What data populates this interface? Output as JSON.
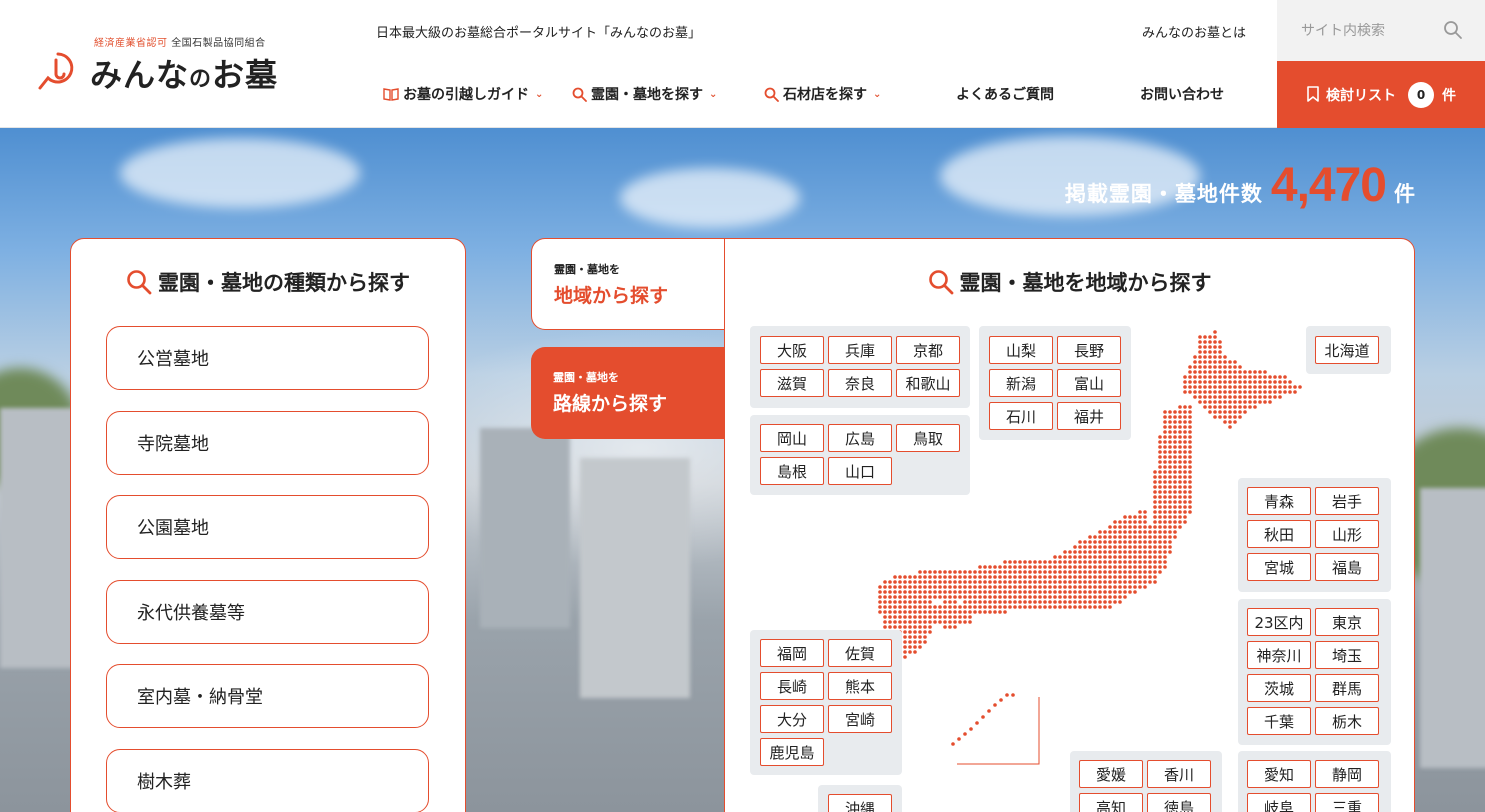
{
  "header": {
    "logo_sub_red": "経済産業省認可",
    "logo_sub": "全国石製品協同組合",
    "logo_name_1": "みんな",
    "logo_name_no": "の",
    "logo_name_2": "お墓",
    "tagline": "日本最大級のお墓総合ポータルサイト「みんなのお墓」",
    "about_link": "みんなのお墓とは",
    "search_placeholder": "サイト内検索",
    "nav": [
      {
        "label": "お墓の引越しガイド"
      },
      {
        "label": "霊園・墓地を探す"
      },
      {
        "label": "石材店を探す"
      },
      {
        "label": "よくあるご質問"
      },
      {
        "label": "お問い合わせ"
      }
    ],
    "list_button": {
      "label": "検討リスト",
      "count": "0",
      "unit": "件"
    }
  },
  "hero": {
    "count_label": "掲載霊園・墓地件数",
    "count_value": "4,470",
    "count_unit": "件"
  },
  "type_panel": {
    "title": "霊園・墓地の種類から探す",
    "items": [
      "公営墓地",
      "寺院墓地",
      "公園墓地",
      "永代供養墓等",
      "室内墓・納骨堂",
      "樹木葬"
    ]
  },
  "tabs": {
    "area": {
      "small": "霊園・墓地を",
      "big": "地域から探す"
    },
    "line": {
      "small": "霊園・墓地を",
      "big": "路線から探す"
    }
  },
  "region_panel": {
    "title": "霊園・墓地を地域から探す",
    "groups": {
      "kinki": [
        "大阪",
        "兵庫",
        "京都",
        "滋賀",
        "奈良",
        "和歌山"
      ],
      "chugoku": [
        "岡山",
        "広島",
        "鳥取",
        "島根",
        "山口"
      ],
      "chubu_n": [
        "山梨",
        "長野",
        "新潟",
        "富山",
        "石川",
        "福井"
      ],
      "hokkaido": [
        "北海道"
      ],
      "tohoku": [
        "青森",
        "岩手",
        "秋田",
        "山形",
        "宮城",
        "福島"
      ],
      "kanto": [
        "23区内",
        "東京",
        "神奈川",
        "埼玉",
        "茨城",
        "群馬",
        "千葉",
        "栃木"
      ],
      "kyushu": [
        "福岡",
        "佐賀",
        "長崎",
        "熊本",
        "大分",
        "宮崎",
        "鹿児島"
      ],
      "okinawa": [
        "沖縄"
      ],
      "shikoku": [
        "愛媛",
        "香川",
        "高知",
        "徳島"
      ],
      "tokai": [
        "愛知",
        "静岡",
        "岐阜",
        "三重"
      ]
    }
  },
  "colors": {
    "accent": "#e44d2e",
    "group_bg": "#e8ebee"
  }
}
